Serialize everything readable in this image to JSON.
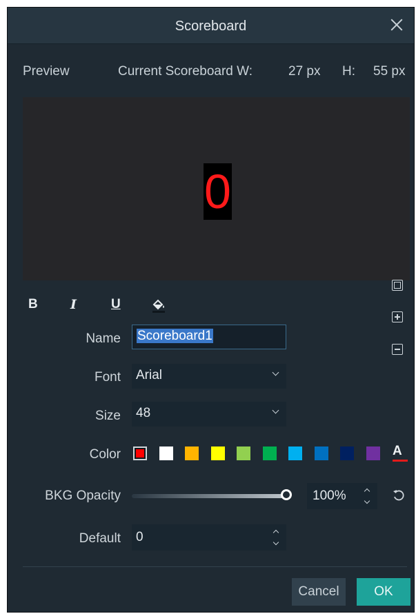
{
  "dialog": {
    "title": "Scoreboard"
  },
  "preview": {
    "label": "Preview",
    "current_label": "Current Scoreboard W:",
    "width_value": "27 px",
    "height_label": "H:",
    "height_value": "55 px",
    "digit": "0",
    "digit_color": "#ff1a1a"
  },
  "format": {
    "bold": "B",
    "italic": "I",
    "underline": "U"
  },
  "fields": {
    "name_label": "Name",
    "name_value": "Scoreboard1",
    "font_label": "Font",
    "font_value": "Arial",
    "size_label": "Size",
    "size_value": "48",
    "color_label": "Color",
    "text_color_glyph": "A",
    "bkg_opacity_label": "BKG Opacity",
    "bkg_opacity_value": "100%",
    "default_label": "Default",
    "default_value": "0"
  },
  "colors": {
    "swatches": [
      "#ff0000",
      "#ffffff",
      "#ffb400",
      "#ffff00",
      "#92d050",
      "#00b050",
      "#00b0f0",
      "#0070c0",
      "#002060",
      "#7030a0"
    ],
    "selected": "#ff0000",
    "accent": "#1ea39a"
  },
  "buttons": {
    "cancel": "Cancel",
    "ok": "OK"
  }
}
